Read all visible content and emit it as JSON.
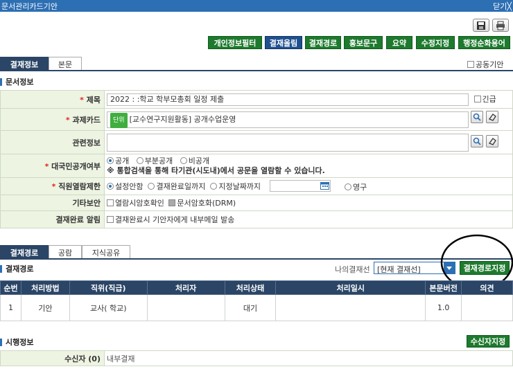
{
  "window": {
    "title": "문서관리카드기안",
    "close": "닫기╳"
  },
  "toolbar_buttons": [
    {
      "label": "개인정보필터",
      "style": "green"
    },
    {
      "label": "결재올림",
      "style": "blue"
    },
    {
      "label": "결재경로",
      "style": "green"
    },
    {
      "label": "홍보문구",
      "style": "green"
    },
    {
      "label": "요약",
      "style": "green"
    },
    {
      "label": "수정지정",
      "style": "green"
    },
    {
      "label": "행정순화용어",
      "style": "green"
    }
  ],
  "top_tabs": [
    "결재정보",
    "본문"
  ],
  "joint_draft": "공동기안",
  "doc_info": {
    "section": "문서정보",
    "title_label": "제목",
    "title_value": "2022 :                        :학교 학부모총회 일정 제출",
    "urgent": "긴급",
    "task_label": "과제카드",
    "task_badge": "단위",
    "task_value": "[교수연구지원활동] 공개수업운영",
    "related_label": "관련정보",
    "public_label": "대국민공개여부",
    "public_options": [
      "공개",
      "부분공개",
      "비공개"
    ],
    "public_note": "※ 통합검색을 통해 타기관(시도내)에서 공문을 열람할 수 있습니다.",
    "staff_label": "직원열람제한",
    "staff_options": [
      "설정안함",
      "결재완료일까지",
      "지정날짜까지"
    ],
    "staff_permanent": "영구",
    "security_label": "기타보안",
    "security_opt1": "열람시암호확인",
    "security_opt2": "문서암호화(DRM)",
    "notify_label": "결재완료 알림",
    "notify_opt": "결재완료시 기안자에게 내부메일 발송"
  },
  "route_tabs": [
    "결재경로",
    "공람",
    "지식공유"
  ],
  "route": {
    "section": "결재경로",
    "my_line_label": "나의결재선",
    "my_line_value": "[현재 결재선]",
    "assign_btn": "결재경로지정",
    "columns": [
      "순번",
      "처리방법",
      "직위(직급)",
      "처리자",
      "처리상태",
      "처리일시",
      "본문버전",
      "의견"
    ],
    "rows": [
      [
        "1",
        "기안",
        "교사(        학교)",
        "",
        "대기",
        "",
        "1.0",
        ""
      ]
    ]
  },
  "exec": {
    "section": "시행정보",
    "recv_btn": "수신자지정",
    "recv_label": "수신자 (0)",
    "recv_value": "내부결재"
  },
  "colors": {
    "titlebar": "#2d6fb3",
    "button_green": "#1e7a2e",
    "button_blue": "#1f4f8f",
    "tab_active": "#2a4566",
    "label_bg": "#edf4e2",
    "required": "#e2261f"
  }
}
